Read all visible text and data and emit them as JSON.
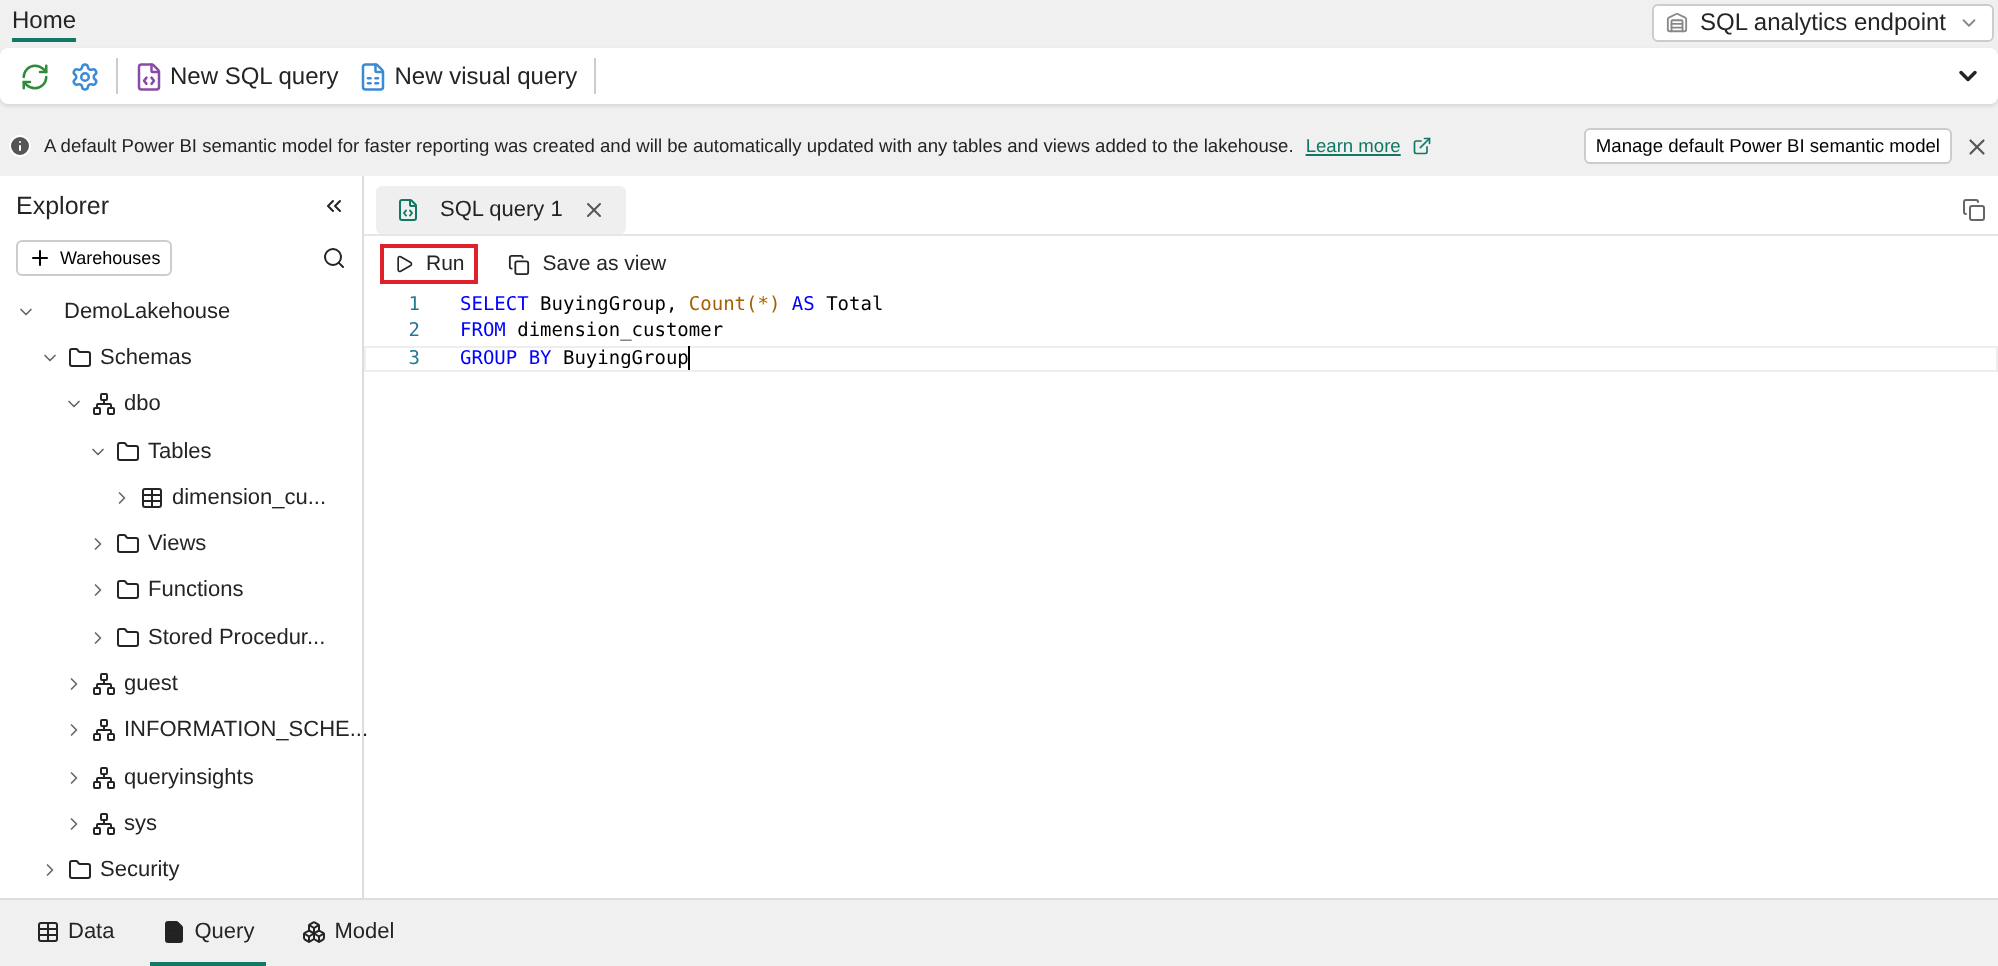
{
  "ribbon": {
    "tabs": [
      {
        "label": "Home",
        "selected": true
      }
    ],
    "endpoint": "SQL analytics endpoint",
    "actions": [
      {
        "kind": "refresh"
      },
      {
        "kind": "settings"
      },
      {
        "kind": "sql",
        "label": "New SQL query"
      },
      {
        "kind": "visual",
        "label": "New visual query"
      }
    ]
  },
  "banner": {
    "text": "A default Power BI semantic model for faster reporting was created and will be automatically updated with any tables and views added to the lakehouse.",
    "link": "Learn more",
    "button": "Manage default Power BI semantic model"
  },
  "explorer": {
    "title": "Explorer",
    "add_button": "Warehouses",
    "tree": [
      {
        "label": "DemoLakehouse",
        "kind": "root",
        "expanded": true,
        "children": [
          {
            "label": "Schemas",
            "kind": "folder",
            "expanded": true,
            "children": [
              {
                "label": "dbo",
                "kind": "schema",
                "expanded": true,
                "children": [
                  {
                    "label": "Tables",
                    "kind": "folder",
                    "expanded": true,
                    "children": [
                      {
                        "label": "dimension_cu...",
                        "kind": "table",
                        "expanded": false
                      }
                    ]
                  },
                  {
                    "label": "Views",
                    "kind": "folder",
                    "expanded": false
                  },
                  {
                    "label": "Functions",
                    "kind": "folder",
                    "expanded": false
                  },
                  {
                    "label": "Stored Procedur...",
                    "kind": "folder",
                    "expanded": false
                  }
                ]
              },
              {
                "label": "guest",
                "kind": "schema",
                "expanded": false
              },
              {
                "label": "INFORMATION_SCHE...",
                "kind": "schema",
                "expanded": false
              },
              {
                "label": "queryinsights",
                "kind": "schema",
                "expanded": false
              },
              {
                "label": "sys",
                "kind": "schema",
                "expanded": false
              }
            ]
          },
          {
            "label": "Security",
            "kind": "folder",
            "expanded": false
          }
        ]
      }
    ]
  },
  "editor": {
    "tabs": [
      {
        "label": "SQL query 1",
        "selected": true
      }
    ],
    "toolbar": [
      {
        "kind": "run",
        "label": "Run",
        "highlighted": true
      },
      {
        "kind": "view",
        "label": "Save as view",
        "highlighted": false
      }
    ],
    "lines": [
      {
        "number": "1",
        "current": false,
        "tokens": [
          {
            "kind": "keyword",
            "text": "SELECT"
          },
          {
            "kind": "plain",
            "text": " BuyingGroup, "
          },
          {
            "kind": "function",
            "text": "Count(*)"
          },
          {
            "kind": "keyword",
            "text": " AS"
          },
          {
            "kind": "plain",
            "text": " Total"
          }
        ]
      },
      {
        "number": "2",
        "current": false,
        "tokens": [
          {
            "kind": "keyword",
            "text": "FROM"
          },
          {
            "kind": "plain",
            "text": " dimension_customer"
          }
        ]
      },
      {
        "number": "3",
        "current": true,
        "tokens": [
          {
            "kind": "keyword",
            "text": "GROUP BY"
          },
          {
            "kind": "plain",
            "text": " BuyingGroup"
          }
        ]
      }
    ]
  },
  "bottom_tabs": [
    {
      "label": "Data",
      "kind": "data",
      "selected": false
    },
    {
      "label": "Query",
      "kind": "query",
      "selected": true
    },
    {
      "label": "Model",
      "kind": "model",
      "selected": false
    }
  ]
}
